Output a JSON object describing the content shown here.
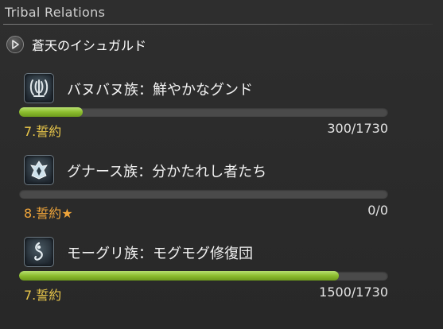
{
  "header": {
    "title": "Tribal Relations"
  },
  "expansion": {
    "label": "蒼天のイシュガルド"
  },
  "tribes": [
    {
      "name": "バヌバヌ族：鮮やかなグンド",
      "rank": "7.誓約",
      "reputation": "300/1730",
      "progress": 0.173,
      "icon": "vanu-vanu-emblem-icon"
    },
    {
      "name": "グナース族：分かたれし者たち",
      "rank": "8.誓約★",
      "reputation": "0/0",
      "progress": 0,
      "icon": "gnath-emblem-icon"
    },
    {
      "name": "モーグリ族：モグモグ修復団",
      "rank": "7.誓約",
      "reputation": "1500/1730",
      "progress": 0.867,
      "icon": "moogle-emblem-icon"
    }
  ],
  "colors": {
    "bar_fill": "#8cbd2e",
    "rank_yellow": "#e8c64a",
    "rank_orange": "#f0a53a"
  }
}
